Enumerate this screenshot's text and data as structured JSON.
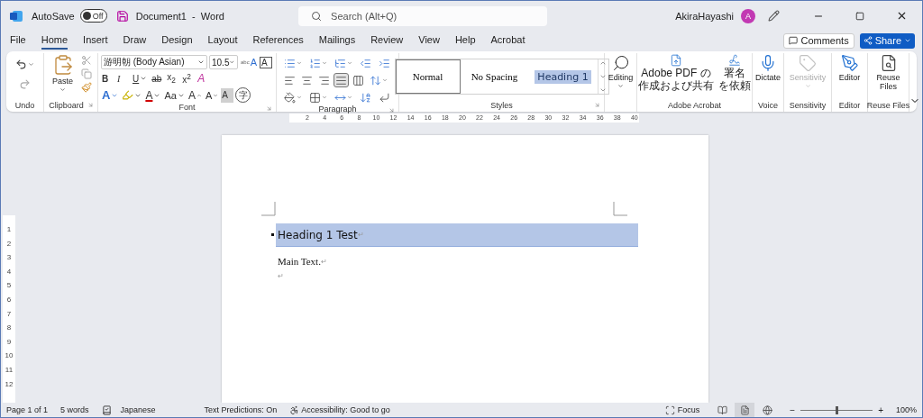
{
  "title_bar": {
    "autosave_label": "AutoSave",
    "autosave": {
      "label": "Off",
      "on": false
    },
    "document_title": "Document1  -  Word",
    "search": {
      "placeholder": "Search (Alt+Q)"
    },
    "user": "AkiraHayashi",
    "avatar_initial": "A"
  },
  "tabs": [
    {
      "label": "File",
      "selected": false
    },
    {
      "label": "Home",
      "selected": true
    },
    {
      "label": "Insert",
      "selected": false
    },
    {
      "label": "Draw",
      "selected": false
    },
    {
      "label": "Design",
      "selected": false
    },
    {
      "label": "Layout",
      "selected": false
    },
    {
      "label": "References",
      "selected": false
    },
    {
      "label": "Mailings",
      "selected": false
    },
    {
      "label": "Review",
      "selected": false
    },
    {
      "label": "View",
      "selected": false
    },
    {
      "label": "Help",
      "selected": false
    },
    {
      "label": "Acrobat",
      "selected": false
    }
  ],
  "actions": {
    "comments": "Comments",
    "share": "Share"
  },
  "ribbon": {
    "undo": {
      "group_label": "Undo"
    },
    "clipboard": {
      "paste": "Paste",
      "group_label": "Clipboard"
    },
    "font": {
      "font_name": "游明朝 (Body Asian)",
      "font_size": "10.5",
      "ruby": {
        "top": "abc",
        "label": "A"
      },
      "border_label": "A",
      "clear_label": "A",
      "format_buttons": [
        {
          "kind": "bold",
          "label": "B"
        },
        {
          "kind": "italic",
          "label": "I"
        },
        {
          "kind": "underline",
          "label": "U"
        },
        {
          "kind": "strike",
          "label": "ab"
        },
        {
          "kind": "script",
          "label": "x$_{2}$"
        },
        {
          "kind": "script",
          "label": "x$^{2}$"
        }
      ],
      "effect_buttons": [
        {
          "kind": "effects",
          "label": "A"
        },
        {
          "kind": "highlight"
        },
        {
          "kind": "color",
          "label": "A"
        },
        {
          "kind": "case",
          "label": "Aa"
        },
        {
          "kind": "grow",
          "label": "A"
        },
        {
          "kind": "shrink",
          "label": "A"
        },
        {
          "kind": "shading",
          "label": "A"
        },
        {
          "kind": "enclose",
          "label": "字"
        }
      ],
      "group_label": "Font"
    },
    "paragraph": {
      "alignment": [
        {
          "kind": "left",
          "selected": false
        },
        {
          "kind": "center",
          "selected": false
        },
        {
          "kind": "right",
          "selected": false
        },
        {
          "kind": "justify",
          "selected": true
        },
        {
          "kind": "distributed",
          "selected": false
        }
      ],
      "group_label": "Paragraph"
    },
    "styles": {
      "items": [
        {
          "kind": "normal",
          "label": "Normal",
          "selected": true
        },
        {
          "kind": "plain",
          "label": "No Spacing",
          "selected": false
        },
        {
          "kind": "heading",
          "label": "Heading 1",
          "selected": false
        }
      ],
      "group_label": "Styles"
    },
    "editing": {
      "label": "Editing"
    },
    "acrobat": {
      "buttons": [
        {
          "kind": "pdf",
          "lines": [
            "Adobe PDF の",
            "作成および共有"
          ]
        },
        {
          "kind": "sign",
          "lines": [
            "署名",
            "を依頼"
          ]
        }
      ],
      "group_label": "Adobe Acrobat"
    },
    "tools": [
      {
        "kind": "dictate",
        "label": "Dictate",
        "group_label": "Voice",
        "disabled": false
      },
      {
        "kind": "sensitivity",
        "label": "Sensitivity",
        "group_label": "Sensitivity",
        "disabled": true
      },
      {
        "kind": "editor",
        "label": "Editor",
        "group_label": "Editor",
        "disabled": false
      },
      {
        "kind": "reuse",
        "label": "Reuse Files",
        "group_label": "Reuse Files",
        "disabled": false
      }
    ]
  },
  "ruler": {
    "numbers": [
      "2",
      "4",
      "6",
      "8",
      "10",
      "12",
      "14",
      "16",
      "18",
      "20",
      "22",
      "24",
      "26",
      "28",
      "30",
      "32",
      "34",
      "36",
      "38",
      "40"
    ]
  },
  "vertical_ruler": {
    "numbers": [
      "1",
      "2",
      "3",
      "4",
      "5",
      "6",
      "7",
      "8",
      "9",
      "10",
      "11",
      "12"
    ]
  },
  "document": {
    "paragraphs": [
      {
        "kind": "heading",
        "text": "Heading 1 Test",
        "mark": "↵",
        "selected": true
      },
      {
        "kind": "body",
        "text": "Main Text.",
        "mark": "↵",
        "selected": false
      },
      {
        "kind": "body",
        "mark": "↵",
        "selected": false
      }
    ]
  },
  "status_bar": {
    "page": "Page 1 of 1",
    "words": "5 words",
    "language": "Japanese",
    "predictions": "Text Predictions: On",
    "accessibility": "Accessibility: Good to go",
    "focus": "Focus",
    "views": [
      {
        "kind": "read",
        "selected": false
      },
      {
        "kind": "print",
        "selected": true
      },
      {
        "kind": "web",
        "selected": false
      }
    ],
    "zoom": {
      "minus": "−",
      "plus": "+",
      "level": 0.5,
      "value": "100%"
    }
  }
}
